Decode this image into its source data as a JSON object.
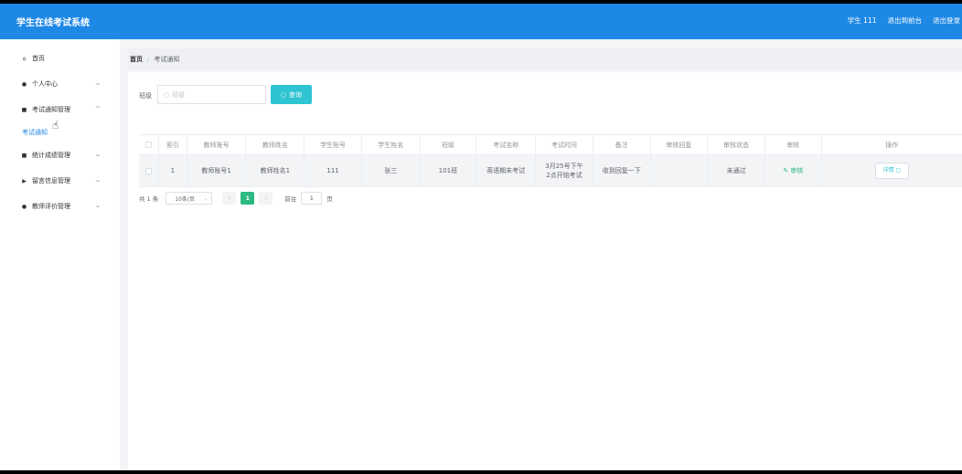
{
  "header": {
    "title": "学生在线考试系统",
    "links": [
      "学生 111",
      "退出到前台",
      "退出登录"
    ]
  },
  "sidebar": {
    "items": [
      {
        "icon": "home-icon",
        "glyph": "⌂",
        "label": "首页",
        "chevron": false
      },
      {
        "icon": "user-icon",
        "glyph": "●",
        "label": "个人中心",
        "chevron": true
      },
      {
        "icon": "notice-icon",
        "glyph": "■",
        "label": "考试通知管理",
        "chevron": true
      },
      {
        "icon": "stats-icon",
        "glyph": "■",
        "label": "统计成绩管理",
        "chevron": true
      },
      {
        "icon": "flag-icon",
        "glyph": "▶",
        "label": "留言信息管理",
        "chevron": true
      },
      {
        "icon": "rating-icon",
        "glyph": "●",
        "label": "教师评价管理",
        "chevron": true
      }
    ],
    "sub_item": "考试通知"
  },
  "breadcrumb": {
    "home": "首页",
    "sep": "/",
    "current": "考试通知"
  },
  "search": {
    "label": "班级",
    "placeholder": "班级",
    "button": "查询"
  },
  "table": {
    "headers": [
      "",
      "索引",
      "教师账号",
      "教师姓名",
      "学生账号",
      "学生姓名",
      "班级",
      "考试名称",
      "考试时间",
      "备注",
      "审核回复",
      "审核状态",
      "审核",
      "操作"
    ],
    "rows": [
      {
        "index": "1",
        "teacher_account": "教师账号1",
        "teacher_name": "教师姓名1",
        "student_account": "111",
        "student_name": "张三",
        "class": "101班",
        "exam_name": "英语期末考试",
        "exam_time": "3月25号下午2点开始考试",
        "remark": "收到回复一下",
        "audit_reply": "",
        "audit_status": "未通过",
        "audit_action": "审核",
        "detail": "详情"
      }
    ]
  },
  "pagination": {
    "total": "共 1 条",
    "page_size": "10条/页",
    "prev": "‹",
    "current_page": "1",
    "next": "›",
    "goto_label": "前往",
    "goto_value": "1",
    "goto_suffix": "页"
  }
}
